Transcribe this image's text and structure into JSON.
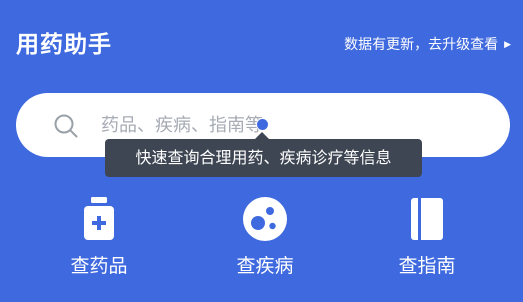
{
  "header": {
    "title": "用药助手",
    "update_text": "数据有更新，去升级查看",
    "update_caret": "▶"
  },
  "search": {
    "placeholder": "药品、疾病、指南等"
  },
  "tooltip": {
    "text": "快速查询合理用药、疾病诊疗等信息"
  },
  "shortcuts": [
    {
      "label": "查药品",
      "icon": "medicine-bottle-icon"
    },
    {
      "label": "查疾病",
      "icon": "virus-icon"
    },
    {
      "label": "查指南",
      "icon": "book-icon"
    }
  ],
  "colors": {
    "background": "#3f69de",
    "tooltip": "#3e4553",
    "placeholder": "#a6abb4"
  }
}
